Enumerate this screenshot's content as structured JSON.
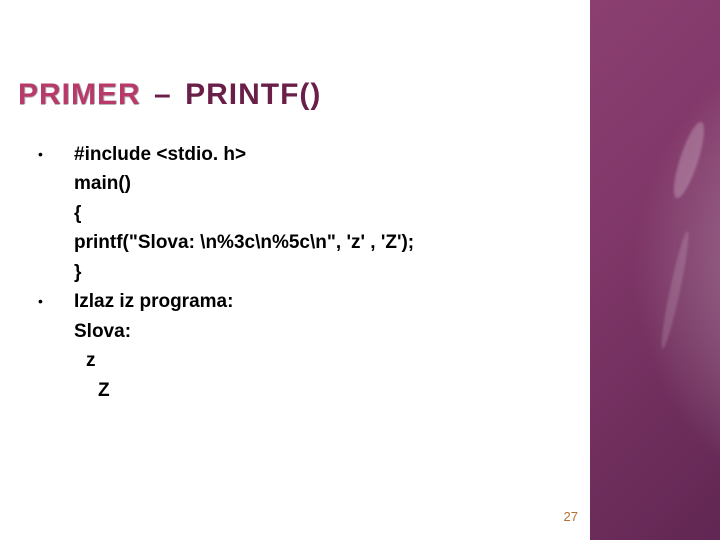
{
  "title": {
    "word1": "PRIMER",
    "dash": "–",
    "word2": "PRINTF()"
  },
  "bullets": {
    "glyph": "•"
  },
  "code": {
    "l1": "#include <stdio. h>",
    "l2": "main()",
    "l3": "{",
    "l4": "printf(\"Slova: \\n%3c\\n%5c\\n\", 'z' , 'Z');",
    "l5": "}"
  },
  "output": {
    "label": "Izlaz iz programa:",
    "l1": "Slova:",
    "l2": "z",
    "l3": "Z"
  },
  "page": {
    "number": "27"
  }
}
